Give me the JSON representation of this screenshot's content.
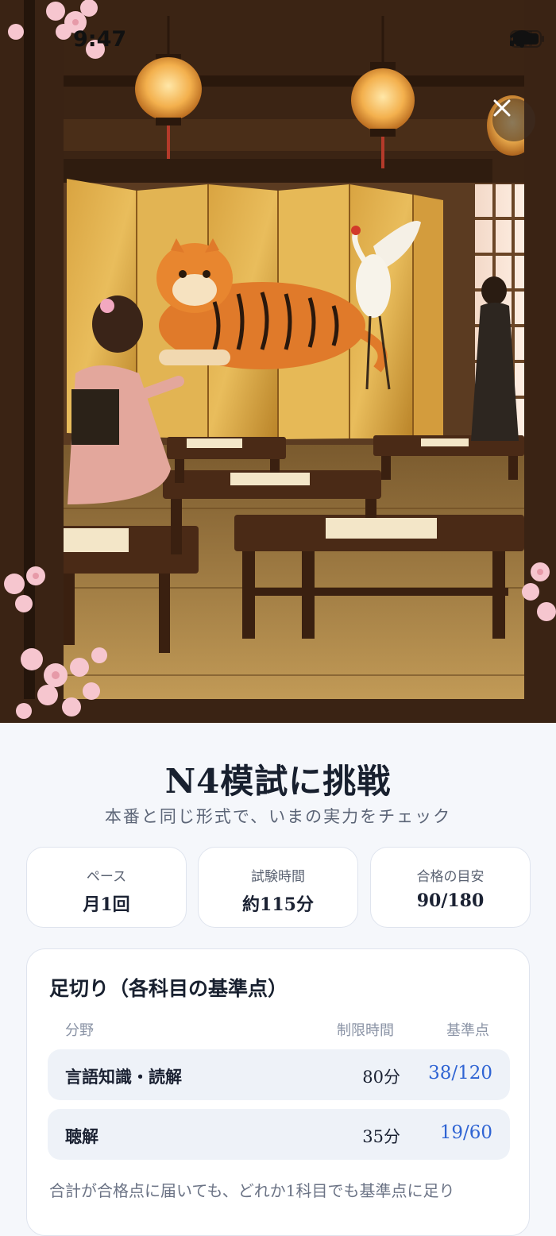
{
  "status_bar": {
    "time": "9:47"
  },
  "icons": {
    "signal": "signal-icon",
    "wifi": "wifi-icon",
    "battery": "battery-icon",
    "close": "close-icon"
  },
  "header": {
    "title": "N4模試に挑戦",
    "subtitle": "本番と同じ形式で、いまの実力をチェック"
  },
  "stats": [
    {
      "label": "ペース",
      "value": "月1回"
    },
    {
      "label": "試験時間",
      "value": "約115分"
    },
    {
      "label": "合格の目安",
      "value": "90/180"
    }
  ],
  "cutoff": {
    "title": "足切り（各科目の基準点）",
    "columns": {
      "area": "分野",
      "time": "制限時間",
      "score": "基準点"
    },
    "rows": [
      {
        "name": "言語知識・読解",
        "time": "80分",
        "score": "38/120"
      },
      {
        "name": "聴解",
        "time": "35分",
        "score": "19/60"
      }
    ],
    "note": "合計が合格点に届いても、どれか1科目でも基準点に足り"
  },
  "colors": {
    "accent": "#2f64d3",
    "background": "#f5f7fb",
    "card_border": "#dfe4ee"
  }
}
